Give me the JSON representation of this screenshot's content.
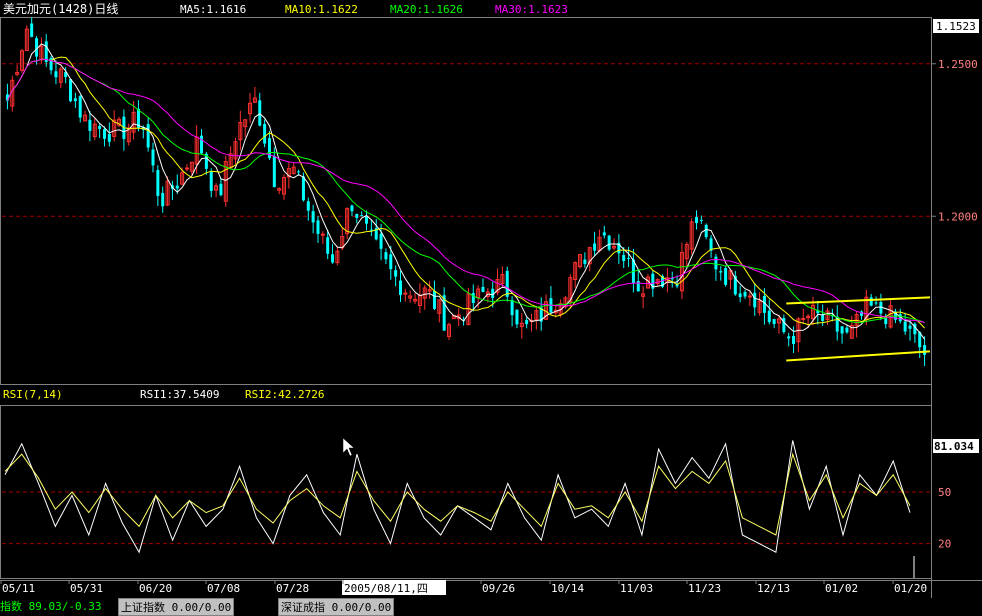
{
  "chart_data": [
    {
      "type": "candlestick",
      "title": "美元加元(1428)日线",
      "ylim": [
        1.145,
        1.265
      ],
      "y_ticks": [
        "1.2500",
        "1.2000"
      ],
      "y_tick_values": [
        1.25,
        1.2
      ],
      "current_price_label": "1.1523",
      "current_price": 1.1523,
      "indicators": [
        {
          "name": "MA5",
          "value": "1.1616",
          "color": "#ffffff"
        },
        {
          "name": "MA10",
          "value": "1.1622",
          "color": "#ffff00"
        },
        {
          "name": "MA20",
          "value": "1.1626",
          "color": "#00ff00"
        },
        {
          "name": "MA30",
          "value": "1.1623",
          "color": "#ff00ff"
        }
      ],
      "up_color": "#ff3030",
      "down_color": "#00ffff",
      "close_anchors": [
        1.238,
        1.262,
        1.25,
        1.245,
        1.232,
        1.228,
        1.228,
        1.232,
        1.205,
        1.212,
        1.225,
        1.205,
        1.228,
        1.238,
        1.212,
        1.215,
        1.198,
        1.185,
        1.205,
        1.192,
        1.182,
        1.175,
        1.175,
        1.165,
        1.17,
        1.175,
        1.178,
        1.162,
        1.168,
        1.175,
        1.185,
        1.195,
        1.19,
        1.178,
        1.18,
        1.18,
        1.2,
        1.185,
        1.178,
        1.175,
        1.165,
        1.16,
        1.168,
        1.165,
        1.16,
        1.17,
        1.168,
        1.163,
        1.155
      ],
      "channel_upper": [
        1.1714,
        1.1734
      ],
      "channel_lower": [
        1.1527,
        1.1557
      ]
    },
    {
      "type": "line",
      "title": "RSI(7,14)",
      "ylim": [
        0,
        100
      ],
      "y_ticks": [
        "50",
        "20"
      ],
      "y_tick_values": [
        50,
        20
      ],
      "current_label": "81.034",
      "current_value": 81.034,
      "x_tick_labels": [
        "05/11",
        "05/31",
        "06/20",
        "07/08",
        "07/28",
        "2005/08/11,四",
        "09/26",
        "10/14",
        "11/03",
        "11/23",
        "12/13",
        "01/02",
        "01/20"
      ],
      "series": [
        {
          "name": "RSI1",
          "value": "37.5409",
          "color": "#ffffff",
          "values": [
            60,
            78,
            55,
            30,
            48,
            25,
            55,
            32,
            15,
            48,
            22,
            45,
            30,
            40,
            65,
            35,
            20,
            48,
            60,
            38,
            25,
            72,
            40,
            20,
            55,
            35,
            25,
            42,
            35,
            28,
            55,
            35,
            22,
            60,
            35,
            40,
            30,
            55,
            25,
            75,
            55,
            70,
            58,
            78,
            25,
            20,
            15,
            80,
            40,
            65,
            25,
            60,
            48,
            68,
            38
          ]
        },
        {
          "name": "RSI2",
          "value": "42.2726",
          "color": "#ffff66",
          "values": [
            62,
            72,
            58,
            40,
            50,
            38,
            52,
            40,
            30,
            48,
            35,
            45,
            38,
            42,
            58,
            40,
            32,
            45,
            52,
            42,
            35,
            62,
            45,
            33,
            50,
            40,
            33,
            42,
            38,
            33,
            50,
            40,
            30,
            55,
            40,
            42,
            35,
            50,
            33,
            65,
            52,
            62,
            55,
            68,
            35,
            30,
            25,
            72,
            45,
            60,
            35,
            55,
            48,
            60,
            42
          ]
        }
      ]
    }
  ],
  "status_bar": {
    "left_text": "指数 89.03/-0.33",
    "index1_label": "上证指数",
    "index1_value": "0.00/0.00",
    "index2_label": "深证成指",
    "index2_value": "0.00/0.00"
  }
}
